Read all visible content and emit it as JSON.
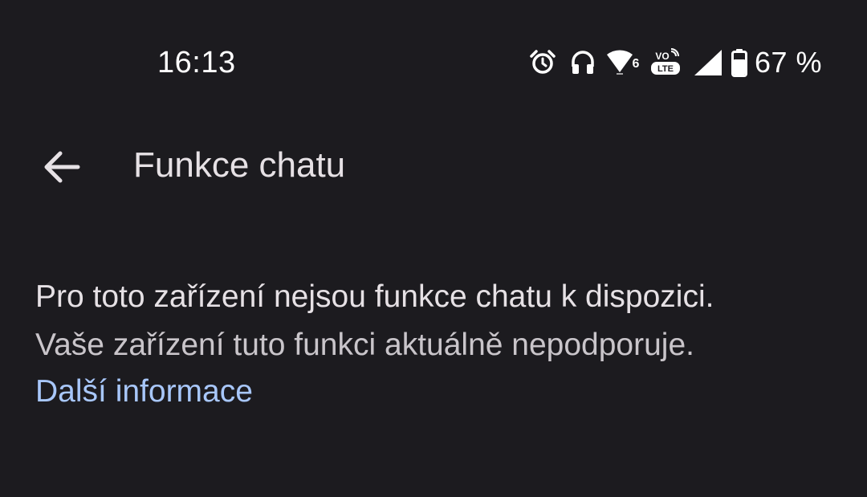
{
  "status_bar": {
    "time": "16:13",
    "icons": [
      "alarm-icon",
      "headphones-icon",
      "wifi-6-icon",
      "volte-icon",
      "cellular-signal-icon",
      "battery-icon"
    ],
    "wifi_badge": "6",
    "volte_top": "VO",
    "volte_bottom": "LTE",
    "battery_percent": "67 %"
  },
  "app_bar": {
    "back_icon": "arrow-back-icon",
    "title": "Funkce chatu"
  },
  "content": {
    "message_primary": "Pro toto zařízení nejsou funkce chatu k dispozici.",
    "message_secondary": "Vaše zařízení tuto funkci aktuálně nepodporuje.",
    "learn_more_link": "Další informace"
  },
  "colors": {
    "background": "#1c1b1f",
    "primary_text": "#e6e1e5",
    "secondary_text": "#c9c5ca",
    "link": "#a8c7fa",
    "status_icons": "#ffffff"
  }
}
